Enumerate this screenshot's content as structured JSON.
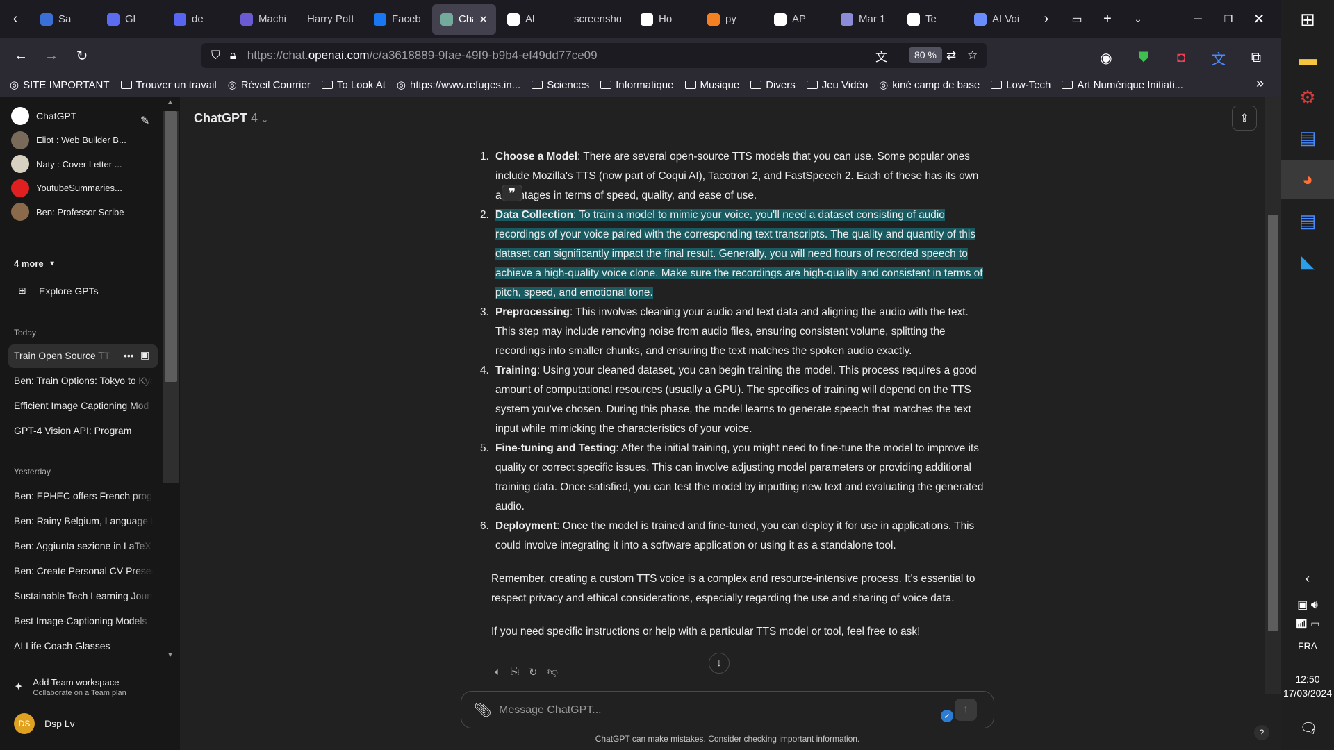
{
  "browser": {
    "tabs": [
      {
        "label": "Sa",
        "icon": "ai-icon",
        "color": "#3a6fd8"
      },
      {
        "label": "Gl",
        "icon": "doc-icon",
        "color": "#5b6cf0"
      },
      {
        "label": "de",
        "icon": "discord-icon",
        "color": "#5865f2"
      },
      {
        "label": "Machi",
        "icon": "co2-icon",
        "color": "#6b5bd2"
      },
      {
        "label": "Harry Pott",
        "icon": "",
        "color": ""
      },
      {
        "label": "Faceb",
        "icon": "facebook-icon",
        "color": "#1877f2"
      },
      {
        "label": "Cha",
        "icon": "chatgpt-icon",
        "color": "#74aa9c",
        "active": true
      },
      {
        "label": "Al",
        "icon": "github-icon",
        "color": "#ffffff"
      },
      {
        "label": "screenshot",
        "icon": "",
        "color": ""
      },
      {
        "label": "Ho",
        "icon": "medium-icon",
        "color": "#ffffff"
      },
      {
        "label": "py",
        "icon": "stack-icon",
        "color": "#f48024"
      },
      {
        "label": "AP",
        "icon": "openai-icon",
        "color": "#ffffff"
      },
      {
        "label": "Mar 1",
        "icon": "perplexity-icon",
        "color": "#8b8bd6"
      },
      {
        "label": "Te",
        "icon": "openai-icon",
        "color": "#ffffff"
      },
      {
        "label": "AI Voi",
        "icon": "wave-icon",
        "color": "#6b8cff"
      }
    ],
    "url_prefix": "https://chat.",
    "url_domain": "openai.com",
    "url_path": "/c/a3618889-9fae-49f9-b9b4-ef49dd77ce09",
    "zoom": "80 %",
    "bookmarks": [
      {
        "label": "SITE IMPORTANT",
        "icon": "globe-icon"
      },
      {
        "label": "Trouver un travail",
        "icon": "folder-icon"
      },
      {
        "label": "Réveil Courrier",
        "icon": "courrier-icon"
      },
      {
        "label": "To Look At",
        "icon": "folder-icon"
      },
      {
        "label": "https://www.refuges.in...",
        "icon": "refuge-icon"
      },
      {
        "label": "Sciences",
        "icon": "folder-icon"
      },
      {
        "label": "Informatique",
        "icon": "folder-icon"
      },
      {
        "label": "Musique",
        "icon": "folder-icon"
      },
      {
        "label": "Divers",
        "icon": "folder-icon"
      },
      {
        "label": "Jeu Vidéo",
        "icon": "folder-icon"
      },
      {
        "label": "kiné camp de base",
        "icon": "kine-icon"
      },
      {
        "label": "Low-Tech",
        "icon": "folder-icon"
      },
      {
        "label": "Art Numérique Initiati...",
        "icon": "folder-icon"
      }
    ]
  },
  "sidebar": {
    "gpts": [
      {
        "label": "ChatGPT",
        "color": "#ffffff"
      },
      {
        "label": "Eliot : Web Builder B...",
        "color": "#7a6a5a"
      },
      {
        "label": "Naty : Cover Letter ...",
        "color": "#d8d0c0"
      },
      {
        "label": "YoutubeSummaries...",
        "color": "#e02020"
      },
      {
        "label": "Ben: Professor Scribe",
        "color": "#8a6a4a"
      }
    ],
    "more_label": "4 more",
    "explore_label": "Explore GPTs",
    "today_label": "Today",
    "today": [
      "Train Open Source TTS.",
      "Ben: Train Options: Tokyo to Kyo",
      "Efficient Image Captioning Mod",
      "GPT-4 Vision API: Program"
    ],
    "yesterday_label": "Yesterday",
    "yesterday": [
      "Ben: EPHEC offers French progr",
      "Ben: Rainy Belgium, Language P",
      "Ben: Aggiunta sezione in LaTeX",
      "Ben: Create Personal CV Presen",
      "Sustainable Tech Learning Journ",
      "Best Image-Captioning Models",
      "AI Life Coach Glasses"
    ],
    "team_title": "Add Team workspace",
    "team_sub": "Collaborate on a Team plan",
    "user_initials": "DS",
    "user_name": "Dsp Lv"
  },
  "chat": {
    "model_name": "ChatGPT",
    "model_version": "4",
    "items": [
      {
        "num": "1.",
        "title": "Choose a Model",
        "text": ": There are several open-source TTS models that you can use. Some popular ones include Mozilla's TTS (now part of Coqui AI), Tacotron 2, and FastSpeech 2. Each of these has its own advantages in terms of speed, quality, and ease of use."
      },
      {
        "num": "2.",
        "title": "Data Collection",
        "text": ": To train a model to mimic your voice, you'll need a dataset consisting of audio recordings of your voice paired with the corresponding text transcripts. The quality and quantity of this dataset can significantly impact the final result. Generally, you will need hours of recorded speech to achieve a high-quality voice clone. Make sure the recordings are high-quality and consistent in terms of pitch, speed, and emotional tone."
      },
      {
        "num": "3.",
        "title": "Preprocessing",
        "text": ": This involves cleaning your audio and text data and aligning the audio with the text. This step may include removing noise from audio files, ensuring consistent volume, splitting the recordings into smaller chunks, and ensuring the text matches the spoken audio exactly."
      },
      {
        "num": "4.",
        "title": "Training",
        "text": ": Using your cleaned dataset, you can begin training the model. This process requires a good amount of computational resources (usually a GPU). The specifics of training will depend on the TTS system you've chosen. During this phase, the model learns to generate speech that matches the text input while mimicking the characteristics of your voice."
      },
      {
        "num": "5.",
        "title": "Fine-tuning and Testing",
        "text": ": After the initial training, you might need to fine-tune the model to improve its quality or correct specific issues. This can involve adjusting model parameters or providing additional training data. Once satisfied, you can test the model by inputting new text and evaluating the generated audio."
      },
      {
        "num": "6.",
        "title": "Deployment",
        "text": ": Once the model is trained and fine-tuned, you can deploy it for use in applications. This could involve integrating it into a software application or using it as a standalone tool."
      }
    ],
    "remember": "Remember, creating a custom TTS voice is a complex and resource-intensive process. It's essential to respect privacy and ethical considerations, especially regarding the use and sharing of voice data.",
    "closing": "If you need specific instructions or help with a particular TTS model or tool, feel free to ask!",
    "composer_placeholder": "Message ChatGPT...",
    "disclaimer": "ChatGPT can make mistakes. Consider checking important information."
  },
  "taskbar": {
    "lang": "FRA",
    "time": "12:50",
    "date": "17/03/2024",
    "notif_count": "7"
  }
}
